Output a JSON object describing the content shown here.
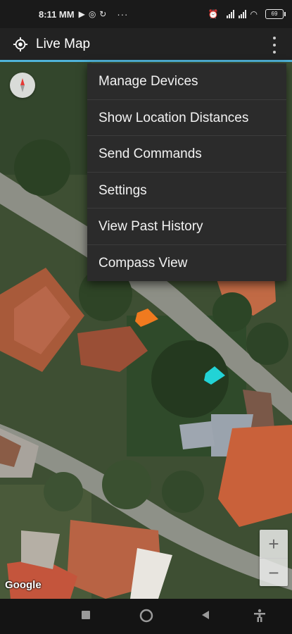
{
  "status_bar": {
    "time": "8:11 MM",
    "battery": "69",
    "overflow_dots": "···"
  },
  "app_bar": {
    "title": "Live Map"
  },
  "menu": {
    "items": [
      {
        "label": "Manage Devices"
      },
      {
        "label": "Show Location Distances"
      },
      {
        "label": "Send Commands"
      },
      {
        "label": "Settings"
      },
      {
        "label": "View Past History"
      },
      {
        "label": "Compass View"
      }
    ]
  },
  "map": {
    "attribution": "Google",
    "zoom_in_label": "+",
    "zoom_out_label": "−",
    "markers": [
      {
        "name": "device-marker-orange",
        "color": "#f07a1f"
      },
      {
        "name": "device-marker-cyan",
        "color": "#22d3d6"
      }
    ]
  },
  "colors": {
    "accent": "#4fb3d9",
    "menu_bg": "#2b2b2b",
    "appbar_bg": "#222222"
  }
}
